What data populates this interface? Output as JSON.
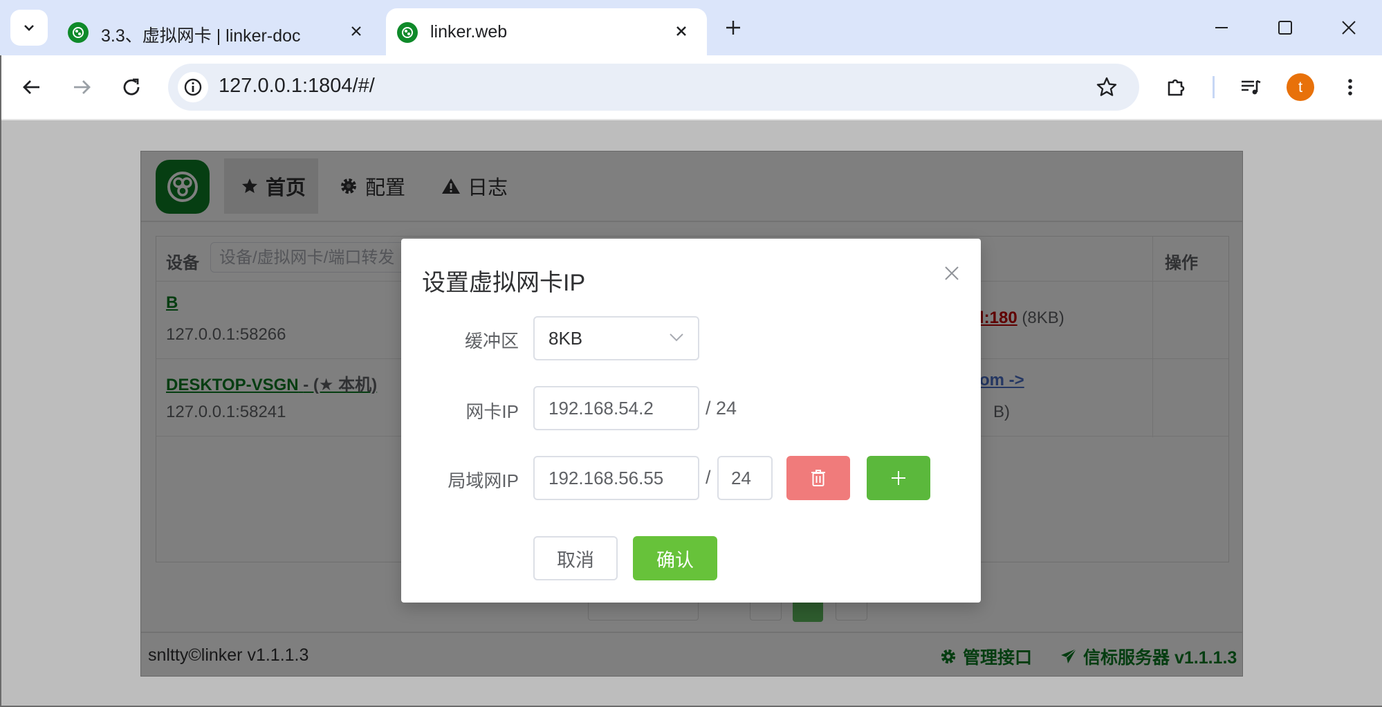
{
  "browser": {
    "tabs": [
      {
        "title": "3.3、虚拟网卡 | linker-doc",
        "active": false
      },
      {
        "title": "linker.web",
        "active": true
      }
    ],
    "url": "127.0.0.1:1804/#/",
    "profile_initial": "t"
  },
  "app": {
    "menu": [
      {
        "label": "首页",
        "icon": "star-icon",
        "active": true
      },
      {
        "label": "配置",
        "icon": "gear-icon",
        "active": false
      },
      {
        "label": "日志",
        "icon": "warning-icon",
        "active": false
      }
    ],
    "table": {
      "device_header": "设备",
      "search_placeholder": "设备/虚拟网卡/端口转发",
      "action_header": "操作",
      "rows": [
        {
          "name": "B",
          "addr": "127.0.0.1:58266",
          "forward_port": "l:180",
          "forward_size": "(8KB)"
        },
        {
          "name": "DESKTOP-VSGN",
          "local_tag": "- (★ 本机)",
          "addr": "127.0.0.1:58241",
          "link": "om ->",
          "size": "B)"
        }
      ]
    },
    "footer": {
      "copyright": "snltty©linker v1.1.1.3",
      "mgmt_label": "管理接口",
      "signal_label": "信标服务器 v1.1.1.3"
    }
  },
  "dialog": {
    "title": "设置虚拟网卡IP",
    "buffer_label": "缓冲区",
    "buffer_value": "8KB",
    "nic_ip_label": "网卡IP",
    "nic_ip_value": "192.168.54.2",
    "nic_mask_text": "/ 24",
    "lan_ip_label": "局域网IP",
    "lan_ip_value": "192.168.56.55",
    "lan_slash": "/",
    "lan_mask_value": "24",
    "cancel_label": "取消",
    "confirm_label": "确认"
  },
  "colors": {
    "brand_green": "#0b7a23",
    "primary": "#67c23a",
    "danger": "#f07b7b",
    "tabstrip": "#dbe5fa"
  }
}
